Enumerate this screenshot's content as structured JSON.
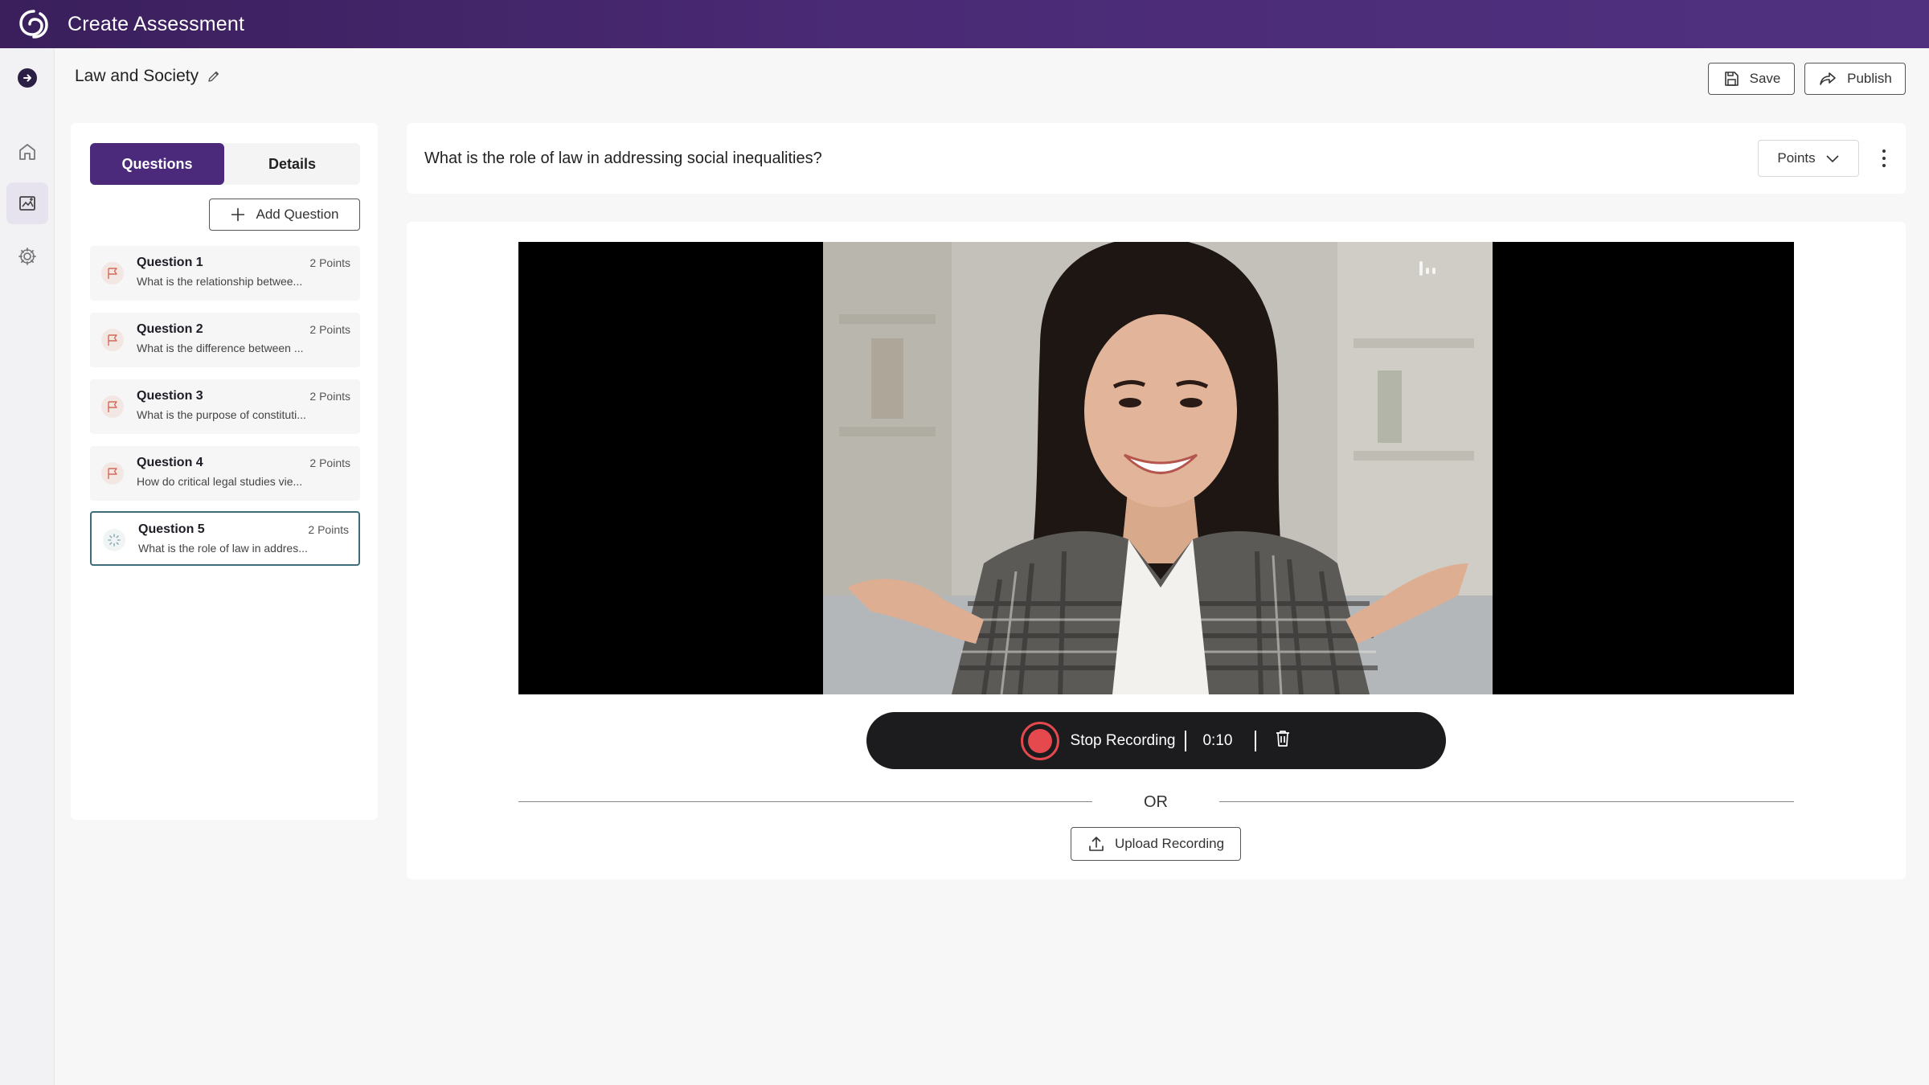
{
  "app": {
    "title": "Create Assessment",
    "logo_icon": "swirl-logo-icon"
  },
  "rail": {
    "items": [
      {
        "name": "home",
        "icon": "home-icon"
      },
      {
        "name": "assessment",
        "icon": "assessment-icon",
        "active": true
      },
      {
        "name": "settings",
        "icon": "gear-icon"
      }
    ]
  },
  "header": {
    "assessment_name": "Law and Society",
    "save_label": "Save",
    "publish_label": "Publish"
  },
  "left_panel": {
    "tabs": [
      {
        "label": "Questions",
        "active": true
      },
      {
        "label": "Details",
        "active": false
      }
    ],
    "add_question_label": "Add Question",
    "questions": [
      {
        "title": "Question 1",
        "points": "2 Points",
        "preview": "What is the relationship betwee...",
        "icon": "flag-icon"
      },
      {
        "title": "Question 2",
        "points": "2 Points",
        "preview": "What is the difference between ...",
        "icon": "flag-icon"
      },
      {
        "title": "Question 3",
        "points": "2 Points",
        "preview": "What is the purpose of constituti...",
        "icon": "flag-icon"
      },
      {
        "title": "Question 4",
        "points": "2 Points",
        "preview": "How do critical legal studies vie...",
        "icon": "flag-icon"
      },
      {
        "title": "Question 5",
        "points": "2 Points",
        "preview": "What is the role of law in addres...",
        "icon": "loading-spinner-icon",
        "selected": true
      }
    ]
  },
  "main": {
    "question_text": "What is the role of law in addressing social inequalities?",
    "points_dropdown": "Points",
    "recording": {
      "stop_label": "Stop Recording",
      "elapsed": "0:10"
    },
    "or_label": "OR",
    "upload_label": "Upload Recording"
  },
  "colors": {
    "brand_purple": "#4b2a7b",
    "record_red": "#e5484d",
    "selected_border": "#3d6b7a"
  }
}
